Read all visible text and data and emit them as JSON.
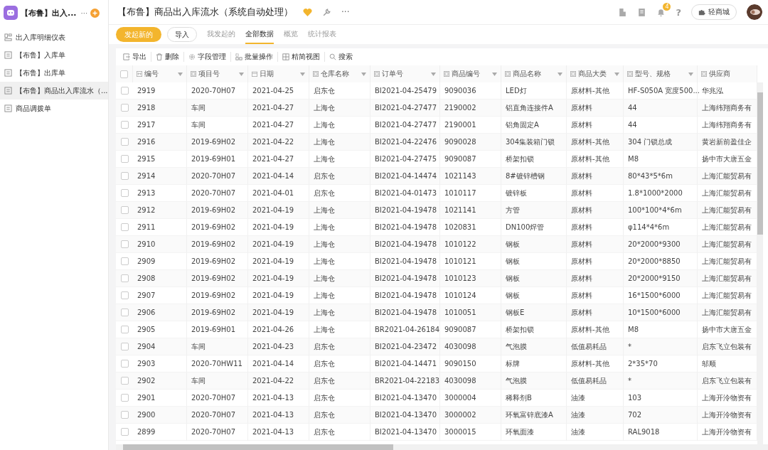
{
  "sidebar": {
    "app_title": "【布鲁】出入...",
    "more": "···",
    "items": [
      {
        "label": "出入库明细仪表",
        "kind": "dashboard",
        "selected": false
      },
      {
        "label": "【布鲁】入库单",
        "kind": "form",
        "selected": false
      },
      {
        "label": "【布鲁】出库单",
        "kind": "form",
        "selected": false
      },
      {
        "label": "【布鲁】商品出入库流水（...",
        "kind": "form",
        "selected": true
      },
      {
        "label": "商品调拨单",
        "kind": "form",
        "selected": false
      }
    ]
  },
  "header": {
    "title": "【布鲁】商品出入库流水（系统自动处理）",
    "more": "···",
    "notification_count": "4",
    "help": "?",
    "store_button": "轻商城"
  },
  "actions": {
    "primary": "发起新的",
    "import": "导入"
  },
  "tabs": [
    {
      "label": "我发起的",
      "selected": false
    },
    {
      "label": "全部数据",
      "selected": true
    },
    {
      "label": "概览",
      "selected": false
    },
    {
      "label": "统计报表",
      "selected": false
    }
  ],
  "toolbar": [
    {
      "label": "导出",
      "kind": "export"
    },
    {
      "label": "删除",
      "kind": "delete"
    },
    {
      "label": "字段管理",
      "kind": "gear"
    },
    {
      "label": "批量操作",
      "kind": "batch"
    },
    {
      "label": "精简视图",
      "kind": "grid"
    },
    {
      "label": "搜索",
      "kind": "search"
    }
  ],
  "table": {
    "select_all_checked": false,
    "columns": [
      {
        "label": "编号",
        "kind": "number",
        "menu": true
      },
      {
        "label": "项目号",
        "kind": "text",
        "menu": true
      },
      {
        "label": "日期",
        "kind": "date",
        "menu": true
      },
      {
        "label": "仓库名称",
        "kind": "text",
        "menu": true
      },
      {
        "label": "订单号",
        "kind": "text",
        "menu": true
      },
      {
        "label": "商品编号",
        "kind": "text",
        "menu": true
      },
      {
        "label": "商品名称",
        "kind": "text",
        "menu": true
      },
      {
        "label": "商品大类",
        "kind": "text",
        "menu": true
      },
      {
        "label": "型号、规格",
        "kind": "text",
        "menu": true
      },
      {
        "label": "供应商",
        "kind": "text",
        "menu": false
      }
    ],
    "rows": [
      {
        "checked": false,
        "cells": [
          "2919",
          "2020-70H07",
          "2021-04-25",
          "启东仓",
          "BI2021-04-25479",
          "9090036",
          "LED灯",
          "原材料-其他",
          "HF-S050A 宽度500...",
          "华兆泓"
        ]
      },
      {
        "checked": false,
        "cells": [
          "2918",
          "车间",
          "2021-04-27",
          "上海仓",
          "BI2021-04-27477",
          "2190002",
          "铝直角连接件A",
          "原材料",
          "44",
          "上海纬翔商务有"
        ]
      },
      {
        "checked": false,
        "cells": [
          "2917",
          "车间",
          "2021-04-27",
          "上海仓",
          "BI2021-04-27477",
          "2190001",
          "铝角固定A",
          "原材料",
          "44",
          "上海纬翔商务有"
        ]
      },
      {
        "checked": false,
        "cells": [
          "2916",
          "2019-69H02",
          "2021-04-22",
          "上海仓",
          "BI2021-04-22476",
          "9090028",
          "304集装箱门锁",
          "原材料-其他",
          "304 门锁总成",
          "黄岩新前盈佳企"
        ]
      },
      {
        "checked": false,
        "cells": [
          "2915",
          "2019-69H01",
          "2021-04-27",
          "上海仓",
          "BI2021-04-27475",
          "9090087",
          "桥架扣锁",
          "原材料-其他",
          "M8",
          "扬中市大唐五金"
        ]
      },
      {
        "checked": false,
        "cells": [
          "2914",
          "2020-70H07",
          "2021-04-14",
          "启东仓",
          "BI2021-04-14474",
          "1021143",
          "8#镀锌槽钢",
          "原材料",
          "80*43*5*6m",
          "上海汇能贸易有"
        ]
      },
      {
        "checked": false,
        "cells": [
          "2913",
          "2020-70H07",
          "2021-04-01",
          "启东仓",
          "BI2021-04-01473",
          "1010117",
          "镀锌板",
          "原材料",
          "1.8*1000*2000",
          "上海汇能贸易有"
        ]
      },
      {
        "checked": false,
        "cells": [
          "2912",
          "2019-69H02",
          "2021-04-19",
          "上海仓",
          "BI2021-04-19478",
          "1021141",
          "方管",
          "原材料",
          "100*100*4*6m",
          "上海汇能贸易有"
        ]
      },
      {
        "checked": false,
        "cells": [
          "2911",
          "2019-69H02",
          "2021-04-19",
          "上海仓",
          "BI2021-04-19478",
          "1020831",
          "DN100焊管",
          "原材料",
          "φ114*4*6m",
          "上海汇能贸易有"
        ]
      },
      {
        "checked": false,
        "cells": [
          "2910",
          "2019-69H02",
          "2021-04-19",
          "上海仓",
          "BI2021-04-19478",
          "1010122",
          "钢板",
          "原材料",
          "20*2000*9300",
          "上海汇能贸易有"
        ]
      },
      {
        "checked": false,
        "cells": [
          "2909",
          "2019-69H02",
          "2021-04-19",
          "上海仓",
          "BI2021-04-19478",
          "1010121",
          "钢板",
          "原材料",
          "20*2000*8850",
          "上海汇能贸易有"
        ]
      },
      {
        "checked": false,
        "cells": [
          "2908",
          "2019-69H02",
          "2021-04-19",
          "上海仓",
          "BI2021-04-19478",
          "1010123",
          "钢板",
          "原材料",
          "20*2000*9150",
          "上海汇能贸易有"
        ]
      },
      {
        "checked": false,
        "cells": [
          "2907",
          "2019-69H02",
          "2021-04-19",
          "上海仓",
          "BI2021-04-19478",
          "1010124",
          "钢板",
          "原材料",
          "16*1500*6000",
          "上海汇能贸易有"
        ]
      },
      {
        "checked": false,
        "cells": [
          "2906",
          "2019-69H02",
          "2021-04-19",
          "上海仓",
          "BI2021-04-19478",
          "1010051",
          "钢板E",
          "原材料",
          "10*1500*6000",
          "上海汇能贸易有"
        ]
      },
      {
        "checked": false,
        "cells": [
          "2905",
          "2019-69H01",
          "2021-04-26",
          "上海仓",
          "BR2021-04-26184",
          "9090087",
          "桥架扣锁",
          "原材料-其他",
          "M8",
          "扬中市大唐五金"
        ]
      },
      {
        "checked": false,
        "cells": [
          "2904",
          "车间",
          "2021-04-23",
          "启东仓",
          "BI2021-04-23472",
          "4030098",
          "气泡膜",
          "低值易耗品",
          "*",
          "启东飞立包装有"
        ]
      },
      {
        "checked": false,
        "cells": [
          "2903",
          "2020-70HW11",
          "2021-04-14",
          "启东仓",
          "BI2021-04-14471",
          "9090150",
          "标牌",
          "原材料-其他",
          "2*35*70",
          "邬顺"
        ]
      },
      {
        "checked": false,
        "cells": [
          "2902",
          "车间",
          "2021-04-22",
          "启东仓",
          "BR2021-04-22183",
          "4030098",
          "气泡膜",
          "低值易耗品",
          "*",
          "启东飞立包装有"
        ]
      },
      {
        "checked": false,
        "cells": [
          "2901",
          "2020-70H07",
          "2021-04-13",
          "启东仓",
          "BI2021-04-13470",
          "3000004",
          "稀释剂B",
          "油漆",
          "103",
          "上海开泠物资有"
        ]
      },
      {
        "checked": false,
        "cells": [
          "2900",
          "2020-70H07",
          "2021-04-13",
          "启东仓",
          "BI2021-04-13470",
          "3000002",
          "环氧富锌底漆A",
          "油漆",
          "702",
          "上海开泠物资有"
        ]
      },
      {
        "checked": false,
        "cells": [
          "2899",
          "2020-70H07",
          "2021-04-13",
          "启东仓",
          "BI2021-04-13470",
          "3000015",
          "环氧面漆",
          "油漆",
          "RAL9018",
          "上海开泠物资有"
        ]
      }
    ]
  }
}
